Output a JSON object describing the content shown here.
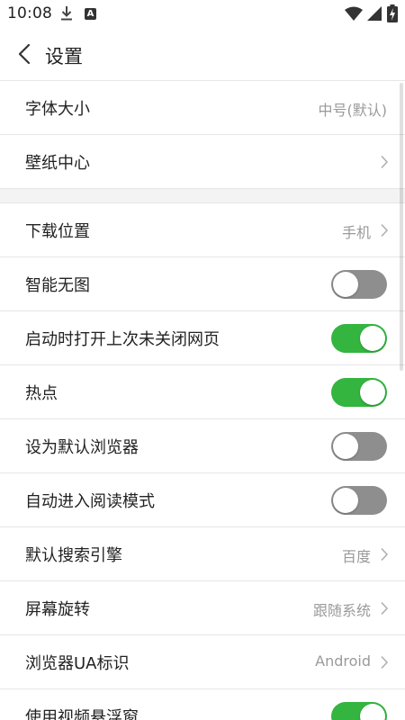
{
  "status_bar": {
    "time": "10:08",
    "icons": [
      "download-icon",
      "app-a-icon",
      "wifi-icon",
      "signal-icon",
      "battery-charging-icon"
    ],
    "badge_letter": "A"
  },
  "header": {
    "back_icon": "back-arrow-icon",
    "title": "设置"
  },
  "colors": {
    "toggle_on": "#33b540",
    "toggle_off": "#8e8e8e",
    "value_text": "#9a9a9a"
  },
  "settings": {
    "font_size": {
      "label": "字体大小",
      "value": "中号(默认)"
    },
    "wallpaper": {
      "label": "壁纸中心"
    },
    "download_location": {
      "label": "下载位置",
      "value": "手机"
    },
    "smart_no_image": {
      "label": "智能无图",
      "enabled": false
    },
    "restore_pages": {
      "label": "启动时打开上次未关闭网页",
      "enabled": true
    },
    "hotspot": {
      "label": "热点",
      "enabled": true
    },
    "default_browser": {
      "label": "设为默认浏览器",
      "enabled": false
    },
    "reading_mode": {
      "label": "自动进入阅读模式",
      "enabled": false
    },
    "search_engine": {
      "label": "默认搜索引擎",
      "value": "百度"
    },
    "screen_rotation": {
      "label": "屏幕旋转",
      "value": "跟随系统"
    },
    "ua": {
      "label": "浏览器UA标识",
      "value": "Android"
    },
    "video_float": {
      "label": "使用视频悬浮窗",
      "enabled": true
    }
  }
}
